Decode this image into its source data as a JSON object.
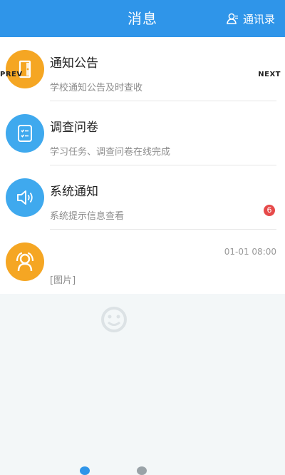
{
  "header": {
    "title": "消息",
    "contacts_label": "通讯录",
    "contacts_icon": "contacts-icon",
    "background": "#2f95e9"
  },
  "carousel": {
    "prev_label": "PREV",
    "next_label": "NEXT"
  },
  "messages": [
    {
      "title": "通知公告",
      "subtitle": "学校通知公告及时查收",
      "icon": "notice-door-icon",
      "icon_color": "#f5a623"
    },
    {
      "title": "调查问卷",
      "subtitle": "学习任务、调查问卷在线完成",
      "icon": "survey-checklist-icon",
      "icon_color": "#3fa9ee"
    },
    {
      "title": "系统通知",
      "subtitle": "系统提示信息查看",
      "icon": "speaker-icon",
      "icon_color": "#3fa9ee",
      "badge": "6",
      "badge_color": "#e64a4a"
    },
    {
      "title": "",
      "subtitle": "[图片]",
      "time": "01-01 08:00",
      "icon": "user-avatar-icon",
      "icon_color": "#f5a623"
    }
  ]
}
